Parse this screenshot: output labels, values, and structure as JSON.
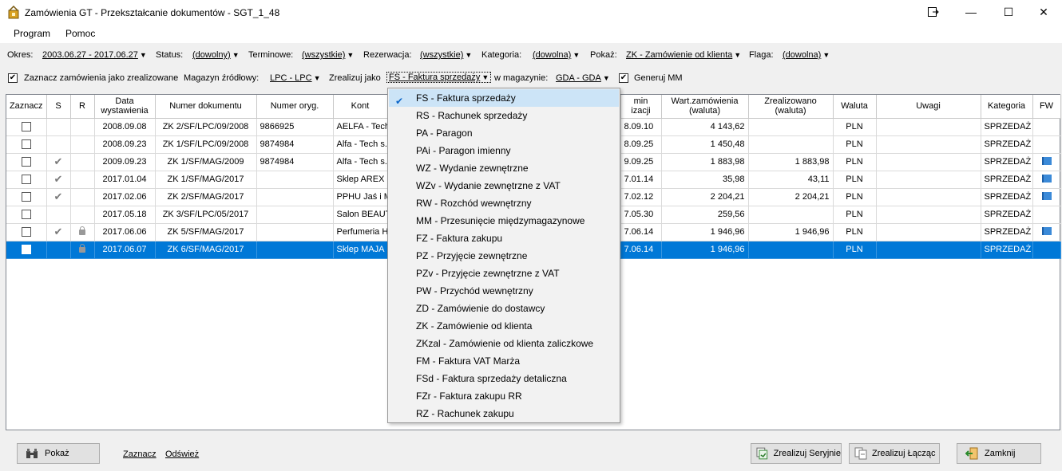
{
  "window": {
    "title": "Zamówienia GT - Przekształcanie dokumentów - SGT_1_48",
    "controls": {
      "restore_icon": "restore-icon",
      "minimize": "—",
      "maximize": "☐",
      "close": "✕"
    }
  },
  "menu": {
    "program": "Program",
    "help": "Pomoc"
  },
  "filters": {
    "period_label": "Okres:",
    "period_value": "2003.06.27 - 2017.06.27",
    "status_label": "Status:",
    "status_value": "(dowolny)",
    "terminowe_label": "Terminowe:",
    "terminowe_value": "(wszystkie)",
    "rezerwacja_label": "Rezerwacja:",
    "rezerwacja_value": "(wszystkie)",
    "kategoria_label": "Kategoria:",
    "kategoria_value": "(dowolna)",
    "pokaz_label": "Pokaż:",
    "pokaz_value": "ZK - Zamówienie od klienta",
    "flaga_label": "Flaga:",
    "flaga_value": "(dowolna)"
  },
  "options": {
    "mark_realized_label": "Zaznacz zamówienia jako zrealizowane",
    "mark_realized_checked": true,
    "source_wh_label": "Magazyn źródłowy:",
    "source_wh_value": "LPC - LPC",
    "realize_as_label": "Zrealizuj jako",
    "realize_as_value": "FS - Faktura sprzedaży",
    "in_wh_label": "w magazynie:",
    "in_wh_value": "GDA - GDA",
    "generate_mm_label": "Generuj MM",
    "generate_mm_checked": true
  },
  "table": {
    "headers": {
      "zaznacz": "Zaznacz",
      "s": "S",
      "r": "R",
      "data1": "Data",
      "data2": "wystawienia",
      "numer": "Numer dokumentu",
      "numer_oryg": "Numer oryg.",
      "kontrahent": "Kont",
      "termin1": "min",
      "termin2": "izacji",
      "wart1": "Wart.zamówienia",
      "wart2": "(waluta)",
      "zreal1": "Zrealizowano",
      "zreal2": "(waluta)",
      "waluta": "Waluta",
      "uwagi": "Uwagi",
      "kategoria": "Kategoria",
      "fw": "FW"
    },
    "rows": [
      {
        "s": "",
        "r": "",
        "data": "2008.09.08",
        "numer": "ZK 2/SF/LPC/09/2008",
        "oryg": "9866925",
        "kontr": "AELFA - Tech",
        "termin": "8.09.10",
        "wart": "4 143,62",
        "zreal": "",
        "waluta": "PLN",
        "kat": "SPRZEDAŻ"
      },
      {
        "s": "",
        "r": "",
        "data": "2008.09.23",
        "numer": "ZK 1/SF/LPC/09/2008",
        "oryg": "9874984",
        "kontr": "Alfa - Tech s.c",
        "termin": "8.09.25",
        "wart": "1 450,48",
        "zreal": "",
        "waluta": "PLN",
        "kat": "SPRZEDAŻ"
      },
      {
        "s": "✔",
        "r": "",
        "data": "2009.09.23",
        "numer": "ZK 1/SF/MAG/2009",
        "oryg": "9874984",
        "kontr": "Alfa - Tech s.c",
        "termin": "9.09.25",
        "wart": "1 883,98",
        "zreal": "1 883,98",
        "waluta": "PLN",
        "kat": "SPRZEDAŻ"
      },
      {
        "s": "✔",
        "r": "",
        "data": "2017.01.04",
        "numer": "ZK 1/SF/MAG/2017",
        "oryg": "",
        "kontr": "Sklep AREX",
        "termin": "7.01.14",
        "wart": "35,98",
        "zreal": "43,11",
        "waluta": "PLN",
        "kat": "SPRZEDAŻ"
      },
      {
        "s": "✔",
        "r": "",
        "data": "2017.02.06",
        "numer": "ZK 2/SF/MAG/2017",
        "oryg": "",
        "kontr": "PPHU Jaś i M",
        "termin": "7.02.12",
        "wart": "2 204,21",
        "zreal": "2 204,21",
        "waluta": "PLN",
        "kat": "SPRZEDAŻ"
      },
      {
        "s": "",
        "r": "",
        "data": "2017.05.18",
        "numer": "ZK 3/SF/LPC/05/2017",
        "oryg": "",
        "kontr": "Salon BEAUT",
        "termin": "7.05.30",
        "wart": "259,56",
        "zreal": "",
        "waluta": "PLN",
        "kat": "SPRZEDAŻ"
      },
      {
        "s": "✔",
        "r": "lock",
        "data": "2017.06.06",
        "numer": "ZK 5/SF/MAG/2017",
        "oryg": "",
        "kontr": "Perfumeria HU",
        "termin": "7.06.14",
        "wart": "1 946,96",
        "zreal": "1 946,96",
        "waluta": "PLN",
        "kat": "SPRZEDAŻ"
      },
      {
        "s": "",
        "r": "lock",
        "data": "2017.06.07",
        "numer": "ZK 6/SF/MAG/2017",
        "oryg": "",
        "kontr": "Sklep MAJA",
        "termin": "7.06.14",
        "wart": "1 946,96",
        "zreal": "",
        "waluta": "PLN",
        "kat": "SPRZEDAŻ"
      }
    ]
  },
  "dropdown": {
    "items": [
      "FS - Faktura sprzedaży",
      "RS - Rachunek sprzedaży",
      "PA - Paragon",
      "PAi - Paragon imienny",
      "WZ - Wydanie zewnętrzne",
      "WZv - Wydanie zewnętrzne z VAT",
      "RW - Rozchód wewnętrzny",
      "MM - Przesunięcie międzymagazynowe",
      "FZ - Faktura zakupu",
      "PZ - Przyjęcie zewnętrzne",
      "PZv - Przyjęcie zewnętrzne z VAT",
      "PW - Przychód wewnętrzny",
      "ZD - Zamówienie do dostawcy",
      "ZK - Zamówienie od klienta",
      "ZKzal - Zamówienie od klienta zaliczkowe",
      "FM - Faktura VAT Marża",
      "FSd - Faktura sprzedaży detaliczna",
      "FZr - Faktura zakupu RR",
      "RZ - Rachunek zakupu"
    ]
  },
  "bottom": {
    "show_button": "Pokaż",
    "mark_link": "Zaznacz",
    "refresh_link": "Odśwież",
    "serial_button": "Zrealizuj Seryjnie",
    "merge_button": "Zrealizuj Łącząc",
    "close_button": "Zamknij"
  },
  "colors": {
    "selection": "#0078d7",
    "flag": "#3b8ad8"
  }
}
